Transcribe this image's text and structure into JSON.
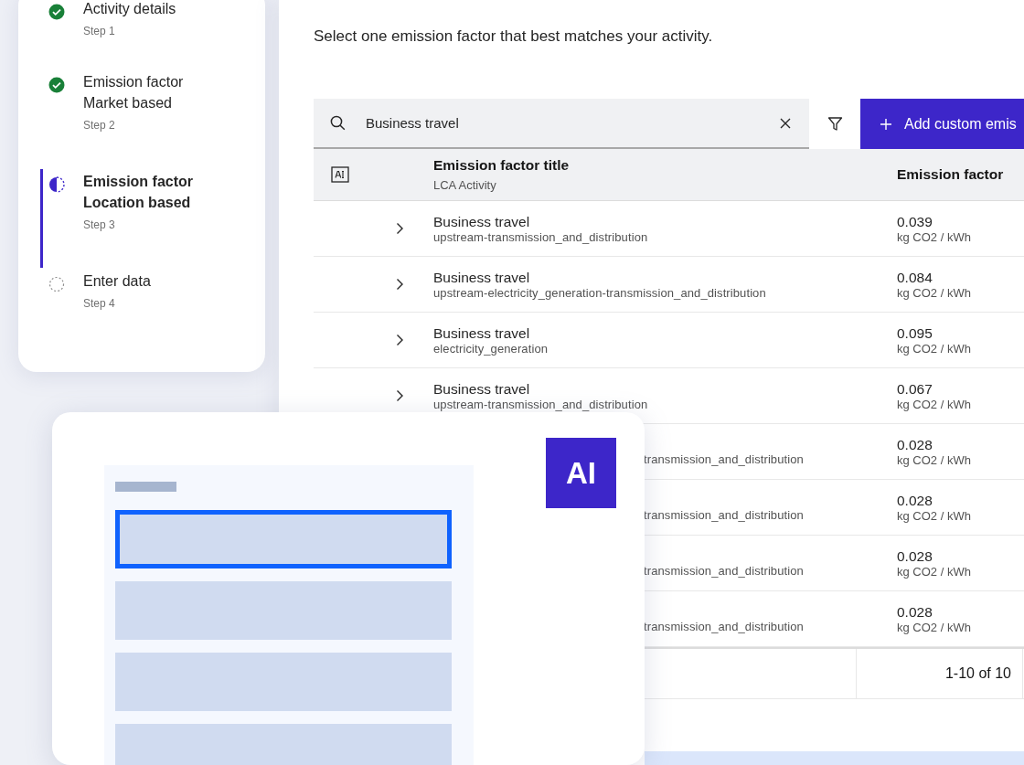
{
  "stepper": {
    "steps": [
      {
        "title": "Activity details",
        "caption": "Step 1",
        "kind": "complete",
        "selected": false
      },
      {
        "title": "Emission factor\nMarket based",
        "caption": "Step 2",
        "kind": "complete",
        "selected": false
      },
      {
        "title": "Emission factor\nLocation based",
        "caption": "Step 3",
        "kind": "current",
        "selected": true
      },
      {
        "title": "Enter data",
        "caption": "Step 4",
        "kind": "incomplete",
        "selected": false
      }
    ]
  },
  "main": {
    "description": "Select one emission factor that best matches your activity.",
    "search": {
      "value": "Business travel"
    },
    "add_button": "Add custom emis",
    "table": {
      "columns": [
        {
          "title": "Emission factor title",
          "subtitle": "LCA Activity"
        },
        {
          "title": "Emission factor"
        }
      ],
      "rows": [
        {
          "kind": "full",
          "title": "Business travel",
          "subtitle": "upstream-transmission_and_distribution",
          "value": "0.039",
          "unit": "kg CO2 / kWh"
        },
        {
          "kind": "full",
          "title": "Business travel",
          "subtitle": "upstream-electricity_generation-transmission_and_distribution",
          "value": "0.084",
          "unit": "kg CO2 / kWh"
        },
        {
          "kind": "full",
          "title": "Business travel",
          "subtitle": "electricity_generation",
          "value": "0.095",
          "unit": "kg CO2 / kWh"
        },
        {
          "kind": "full",
          "title": "Business travel",
          "subtitle": "upstream-transmission_and_distribution",
          "value": "0.067",
          "unit": "kg CO2 / kWh"
        },
        {
          "kind": "partial",
          "subtitle": "transmission_and_distribution",
          "value": "0.028",
          "unit": "kg CO2 / kWh"
        },
        {
          "kind": "partial",
          "subtitle": "transmission_and_distribution",
          "value": "0.028",
          "unit": "kg CO2 / kWh"
        },
        {
          "kind": "partial",
          "subtitle": "transmission_and_distribution",
          "value": "0.028",
          "unit": "kg CO2 / kWh"
        },
        {
          "kind": "partial",
          "subtitle": "transmission_and_distribution",
          "value": "0.028",
          "unit": "kg CO2 / kWh"
        }
      ],
      "pagination": "1-10 of 10"
    }
  },
  "ai_card": {
    "badge": "AI",
    "items": [
      {
        "selected": true
      },
      {
        "selected": false
      },
      {
        "selected": false
      },
      {
        "selected": false
      }
    ]
  }
}
